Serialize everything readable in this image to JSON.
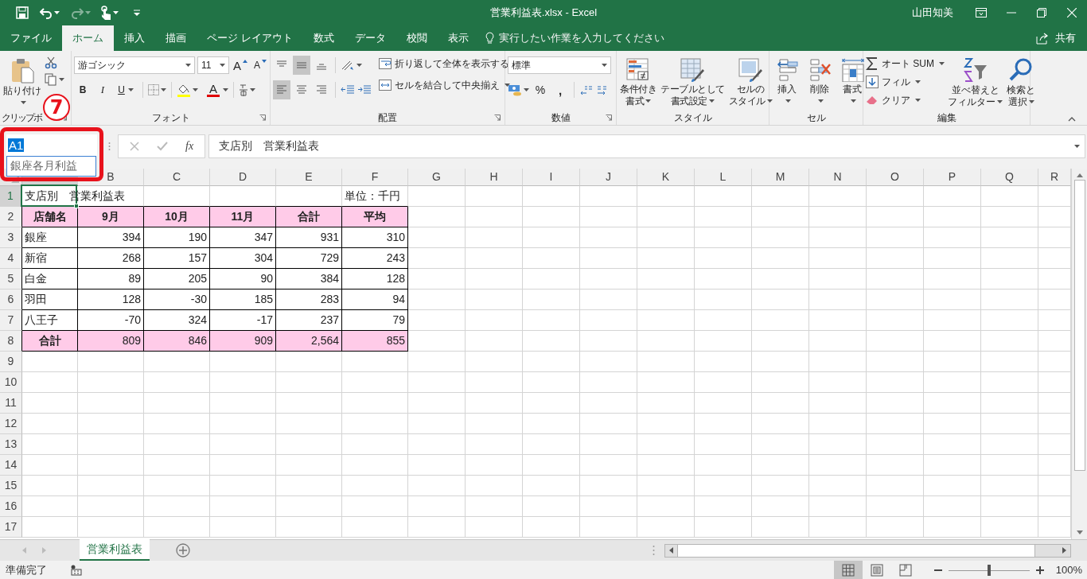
{
  "window": {
    "title": "営業利益表.xlsx - Excel",
    "user": "山田知美"
  },
  "menu_tabs": [
    {
      "label": "ファイル",
      "selected": false
    },
    {
      "label": "ホーム",
      "selected": true
    },
    {
      "label": "挿入",
      "selected": false
    },
    {
      "label": "描画",
      "selected": false
    },
    {
      "label": "ページ レイアウト",
      "selected": false
    },
    {
      "label": "数式",
      "selected": false
    },
    {
      "label": "データ",
      "selected": false
    },
    {
      "label": "校閲",
      "selected": false
    },
    {
      "label": "表示",
      "selected": false
    }
  ],
  "tell_me": "実行したい作業を入力してください",
  "share": "共有",
  "ribbon": [
    {
      "kind": "clipboard",
      "label": "クリップボ",
      "paste": "貼り付け"
    },
    {
      "kind": "font",
      "label": "フォント",
      "font_name": "游ゴシック",
      "font_size": "11",
      "grow": "A",
      "shrink": "A",
      "bold": "B",
      "italic": "I",
      "underline": "U",
      "font_color": "A"
    },
    {
      "kind": "alignment",
      "label": "配置",
      "vertical": [
        {
          "kind": "top",
          "selected": false
        },
        {
          "kind": "middle",
          "selected": true
        },
        {
          "kind": "bottom",
          "selected": false
        }
      ],
      "horizontal": [
        {
          "kind": "left",
          "selected": true
        },
        {
          "kind": "center",
          "selected": false
        },
        {
          "kind": "right",
          "selected": false
        }
      ],
      "wrap": "折り返して全体を表示する",
      "merge": "セルを結合して中央揃え"
    },
    {
      "kind": "number",
      "label": "数値",
      "format": "標準",
      "percent": "%",
      "comma": ","
    },
    {
      "kind": "styles",
      "label": "スタイル",
      "buttons": [
        {
          "kind": "conditional",
          "label": [
            "条件付き",
            "書式"
          ]
        },
        {
          "kind": "table",
          "label": [
            "テーブルとして",
            "書式設定"
          ]
        },
        {
          "kind": "cell_styles",
          "label": [
            "セルの",
            "スタイル"
          ]
        }
      ]
    },
    {
      "kind": "cells",
      "label": "セル",
      "buttons": [
        {
          "kind": "insert",
          "label": "挿入"
        },
        {
          "kind": "delete",
          "label": "削除"
        },
        {
          "kind": "format",
          "label": "書式"
        }
      ]
    },
    {
      "kind": "editing",
      "label": "編集",
      "autosum": "オート SUM",
      "fill": "フィル",
      "clear": "クリア",
      "sort": [
        "並べ替えと",
        "フィルター"
      ],
      "find": [
        "検索と",
        "選択"
      ]
    }
  ],
  "formula_bar": {
    "name_box": "A1",
    "autocomplete": "銀座各月利益",
    "fx": "fx",
    "formula": "支店別　営業利益表"
  },
  "annotation": {
    "marker": "7"
  },
  "sheet": {
    "columns": [
      "B",
      "C",
      "D",
      "E",
      "F",
      "G",
      "H",
      "I",
      "J",
      "K",
      "L",
      "M",
      "N",
      "O",
      "P",
      "Q",
      "R"
    ],
    "rows": [
      {
        "header": "1",
        "kind": "title",
        "title": {
          "text": "支店別　営業利益表",
          "selected": true
        },
        "unit": {
          "text": "単位：千円",
          "selected": false
        }
      },
      {
        "header": "2",
        "kind": "header",
        "cells": [
          {
            "text": "店舗名",
            "kind": "text",
            "selected": false
          },
          {
            "text": "9月",
            "kind": "text",
            "selected": false
          },
          {
            "text": "10月",
            "kind": "text",
            "selected": false
          },
          {
            "text": "11月",
            "kind": "text",
            "selected": false
          },
          {
            "text": "合計",
            "kind": "text",
            "selected": false
          },
          {
            "text": "平均",
            "kind": "text",
            "selected": false
          }
        ]
      },
      {
        "header": "3",
        "kind": "data",
        "cells": [
          {
            "text": "銀座",
            "kind": "text",
            "selected": false
          },
          {
            "text": "394",
            "kind": "number",
            "selected": false
          },
          {
            "text": "190",
            "kind": "number",
            "selected": false
          },
          {
            "text": "347",
            "kind": "number",
            "selected": false
          },
          {
            "text": "931",
            "kind": "number",
            "selected": false
          },
          {
            "text": "310",
            "kind": "number",
            "selected": false
          }
        ]
      },
      {
        "header": "4",
        "kind": "data",
        "cells": [
          {
            "text": "新宿",
            "kind": "text",
            "selected": false
          },
          {
            "text": "268",
            "kind": "number",
            "selected": false
          },
          {
            "text": "157",
            "kind": "number",
            "selected": false
          },
          {
            "text": "304",
            "kind": "number",
            "selected": false
          },
          {
            "text": "729",
            "kind": "number",
            "selected": false
          },
          {
            "text": "243",
            "kind": "number",
            "selected": false
          }
        ]
      },
      {
        "header": "5",
        "kind": "data",
        "cells": [
          {
            "text": "白金",
            "kind": "text",
            "selected": false
          },
          {
            "text": "89",
            "kind": "number",
            "selected": false
          },
          {
            "text": "205",
            "kind": "number",
            "selected": false
          },
          {
            "text": "90",
            "kind": "number",
            "selected": false
          },
          {
            "text": "384",
            "kind": "number",
            "selected": false
          },
          {
            "text": "128",
            "kind": "number",
            "selected": false
          }
        ]
      },
      {
        "header": "6",
        "kind": "data",
        "cells": [
          {
            "text": "羽田",
            "kind": "text",
            "selected": false
          },
          {
            "text": "128",
            "kind": "number",
            "selected": false
          },
          {
            "text": "-30",
            "kind": "number",
            "selected": false
          },
          {
            "text": "185",
            "kind": "number",
            "selected": false
          },
          {
            "text": "283",
            "kind": "number",
            "selected": false
          },
          {
            "text": "94",
            "kind": "number",
            "selected": false
          }
        ]
      },
      {
        "header": "7",
        "kind": "data",
        "cells": [
          {
            "text": "八王子",
            "kind": "text",
            "selected": false
          },
          {
            "text": "-70",
            "kind": "number",
            "selected": false
          },
          {
            "text": "324",
            "kind": "number",
            "selected": false
          },
          {
            "text": "-17",
            "kind": "number",
            "selected": false
          },
          {
            "text": "237",
            "kind": "number",
            "selected": false
          },
          {
            "text": "79",
            "kind": "number",
            "selected": false
          }
        ]
      },
      {
        "header": "8",
        "kind": "total",
        "cells": [
          {
            "text": "合計",
            "kind": "text",
            "selected": false
          },
          {
            "text": "809",
            "kind": "number",
            "selected": false
          },
          {
            "text": "846",
            "kind": "number",
            "selected": false
          },
          {
            "text": "909",
            "kind": "number",
            "selected": false
          },
          {
            "text": "2,564",
            "kind": "number",
            "selected": false
          },
          {
            "text": "855",
            "kind": "number",
            "selected": false
          }
        ]
      },
      {
        "header": "9",
        "kind": "empty"
      },
      {
        "header": "10",
        "kind": "empty"
      },
      {
        "header": "11",
        "kind": "empty"
      },
      {
        "header": "12",
        "kind": "empty"
      },
      {
        "header": "13",
        "kind": "empty"
      },
      {
        "header": "14",
        "kind": "empty"
      },
      {
        "header": "15",
        "kind": "empty"
      },
      {
        "header": "16",
        "kind": "empty"
      },
      {
        "header": "17",
        "kind": "empty"
      }
    ]
  },
  "sheet_tabs": [
    {
      "label": "営業利益表",
      "selected": true
    }
  ],
  "status_bar": {
    "status": "準備完了",
    "views": [
      {
        "kind": "normal",
        "selected": true
      },
      {
        "kind": "page_layout",
        "selected": false
      },
      {
        "kind": "page_break",
        "selected": false
      }
    ],
    "zoom": {
      "level": 0.5,
      "reading": "100%"
    }
  }
}
